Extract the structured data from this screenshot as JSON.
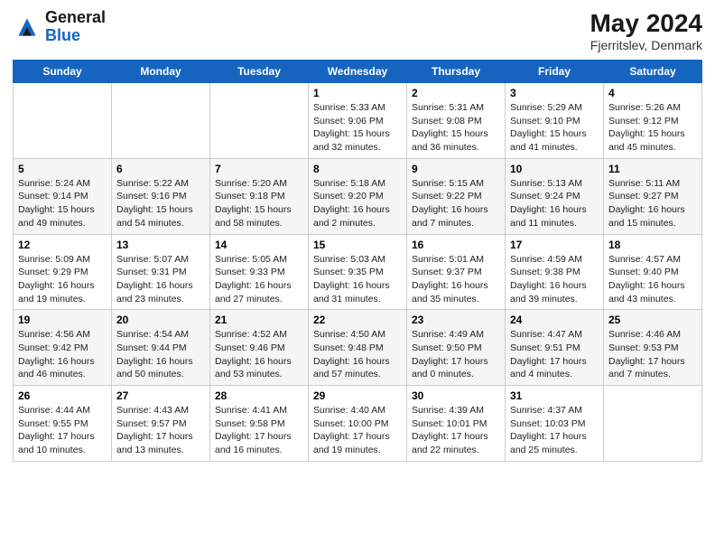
{
  "logo": {
    "line1": "General",
    "line2": "Blue"
  },
  "title": "May 2024",
  "location": "Fjerritslev, Denmark",
  "days_header": [
    "Sunday",
    "Monday",
    "Tuesday",
    "Wednesday",
    "Thursday",
    "Friday",
    "Saturday"
  ],
  "weeks": [
    [
      {
        "day": "",
        "info": ""
      },
      {
        "day": "",
        "info": ""
      },
      {
        "day": "",
        "info": ""
      },
      {
        "day": "1",
        "info": "Sunrise: 5:33 AM\nSunset: 9:06 PM\nDaylight: 15 hours\nand 32 minutes."
      },
      {
        "day": "2",
        "info": "Sunrise: 5:31 AM\nSunset: 9:08 PM\nDaylight: 15 hours\nand 36 minutes."
      },
      {
        "day": "3",
        "info": "Sunrise: 5:29 AM\nSunset: 9:10 PM\nDaylight: 15 hours\nand 41 minutes."
      },
      {
        "day": "4",
        "info": "Sunrise: 5:26 AM\nSunset: 9:12 PM\nDaylight: 15 hours\nand 45 minutes."
      }
    ],
    [
      {
        "day": "5",
        "info": "Sunrise: 5:24 AM\nSunset: 9:14 PM\nDaylight: 15 hours\nand 49 minutes."
      },
      {
        "day": "6",
        "info": "Sunrise: 5:22 AM\nSunset: 9:16 PM\nDaylight: 15 hours\nand 54 minutes."
      },
      {
        "day": "7",
        "info": "Sunrise: 5:20 AM\nSunset: 9:18 PM\nDaylight: 15 hours\nand 58 minutes."
      },
      {
        "day": "8",
        "info": "Sunrise: 5:18 AM\nSunset: 9:20 PM\nDaylight: 16 hours\nand 2 minutes."
      },
      {
        "day": "9",
        "info": "Sunrise: 5:15 AM\nSunset: 9:22 PM\nDaylight: 16 hours\nand 7 minutes."
      },
      {
        "day": "10",
        "info": "Sunrise: 5:13 AM\nSunset: 9:24 PM\nDaylight: 16 hours\nand 11 minutes."
      },
      {
        "day": "11",
        "info": "Sunrise: 5:11 AM\nSunset: 9:27 PM\nDaylight: 16 hours\nand 15 minutes."
      }
    ],
    [
      {
        "day": "12",
        "info": "Sunrise: 5:09 AM\nSunset: 9:29 PM\nDaylight: 16 hours\nand 19 minutes."
      },
      {
        "day": "13",
        "info": "Sunrise: 5:07 AM\nSunset: 9:31 PM\nDaylight: 16 hours\nand 23 minutes."
      },
      {
        "day": "14",
        "info": "Sunrise: 5:05 AM\nSunset: 9:33 PM\nDaylight: 16 hours\nand 27 minutes."
      },
      {
        "day": "15",
        "info": "Sunrise: 5:03 AM\nSunset: 9:35 PM\nDaylight: 16 hours\nand 31 minutes."
      },
      {
        "day": "16",
        "info": "Sunrise: 5:01 AM\nSunset: 9:37 PM\nDaylight: 16 hours\nand 35 minutes."
      },
      {
        "day": "17",
        "info": "Sunrise: 4:59 AM\nSunset: 9:38 PM\nDaylight: 16 hours\nand 39 minutes."
      },
      {
        "day": "18",
        "info": "Sunrise: 4:57 AM\nSunset: 9:40 PM\nDaylight: 16 hours\nand 43 minutes."
      }
    ],
    [
      {
        "day": "19",
        "info": "Sunrise: 4:56 AM\nSunset: 9:42 PM\nDaylight: 16 hours\nand 46 minutes."
      },
      {
        "day": "20",
        "info": "Sunrise: 4:54 AM\nSunset: 9:44 PM\nDaylight: 16 hours\nand 50 minutes."
      },
      {
        "day": "21",
        "info": "Sunrise: 4:52 AM\nSunset: 9:46 PM\nDaylight: 16 hours\nand 53 minutes."
      },
      {
        "day": "22",
        "info": "Sunrise: 4:50 AM\nSunset: 9:48 PM\nDaylight: 16 hours\nand 57 minutes."
      },
      {
        "day": "23",
        "info": "Sunrise: 4:49 AM\nSunset: 9:50 PM\nDaylight: 17 hours\nand 0 minutes."
      },
      {
        "day": "24",
        "info": "Sunrise: 4:47 AM\nSunset: 9:51 PM\nDaylight: 17 hours\nand 4 minutes."
      },
      {
        "day": "25",
        "info": "Sunrise: 4:46 AM\nSunset: 9:53 PM\nDaylight: 17 hours\nand 7 minutes."
      }
    ],
    [
      {
        "day": "26",
        "info": "Sunrise: 4:44 AM\nSunset: 9:55 PM\nDaylight: 17 hours\nand 10 minutes."
      },
      {
        "day": "27",
        "info": "Sunrise: 4:43 AM\nSunset: 9:57 PM\nDaylight: 17 hours\nand 13 minutes."
      },
      {
        "day": "28",
        "info": "Sunrise: 4:41 AM\nSunset: 9:58 PM\nDaylight: 17 hours\nand 16 minutes."
      },
      {
        "day": "29",
        "info": "Sunrise: 4:40 AM\nSunset: 10:00 PM\nDaylight: 17 hours\nand 19 minutes."
      },
      {
        "day": "30",
        "info": "Sunrise: 4:39 AM\nSunset: 10:01 PM\nDaylight: 17 hours\nand 22 minutes."
      },
      {
        "day": "31",
        "info": "Sunrise: 4:37 AM\nSunset: 10:03 PM\nDaylight: 17 hours\nand 25 minutes."
      },
      {
        "day": "",
        "info": ""
      }
    ]
  ]
}
